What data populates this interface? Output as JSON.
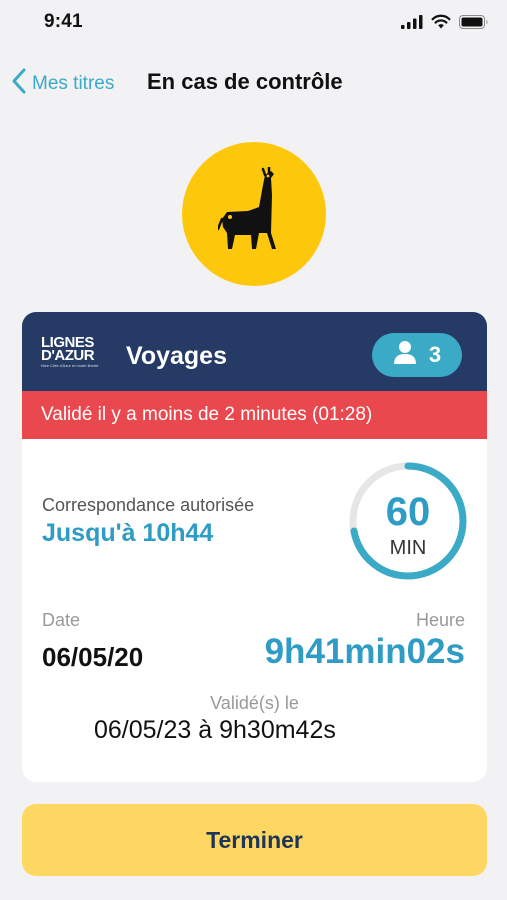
{
  "status_bar": {
    "time": "9:41",
    "icons": [
      "signal-icon",
      "wifi-icon",
      "battery-icon"
    ]
  },
  "nav": {
    "back_label": "Mes titres",
    "title": "En cas de contrôle"
  },
  "avatar": {
    "icon": "giraffe-icon",
    "background": "#fdc80b"
  },
  "ticket": {
    "logo": {
      "line1": "LIGNES",
      "line2": "D'AZUR",
      "tagline": "Nice Côte d'Azur en toute liberté"
    },
    "title": "Voyages",
    "passengers": "3",
    "validated_banner": "Validé il y a moins de 2 minutes (01:28)",
    "correspondance_label": "Correspondance autorisée",
    "correspondance_value": "Jusqu'à 10h44",
    "timer": {
      "value": "60",
      "unit": "MIN",
      "progress": 0.72
    },
    "date_label": "Date",
    "date_value": "06/05/20",
    "time_label": "Heure",
    "time_value": "9h41min02s",
    "validated_label": "Validé(s) le",
    "validated_value": "06/05/23 à 9h30m42s"
  },
  "finish_button": "Terminer",
  "colors": {
    "accent": "#3aaac6",
    "header": "#253a64",
    "alert": "#e9484f",
    "button": "#fdd762"
  }
}
